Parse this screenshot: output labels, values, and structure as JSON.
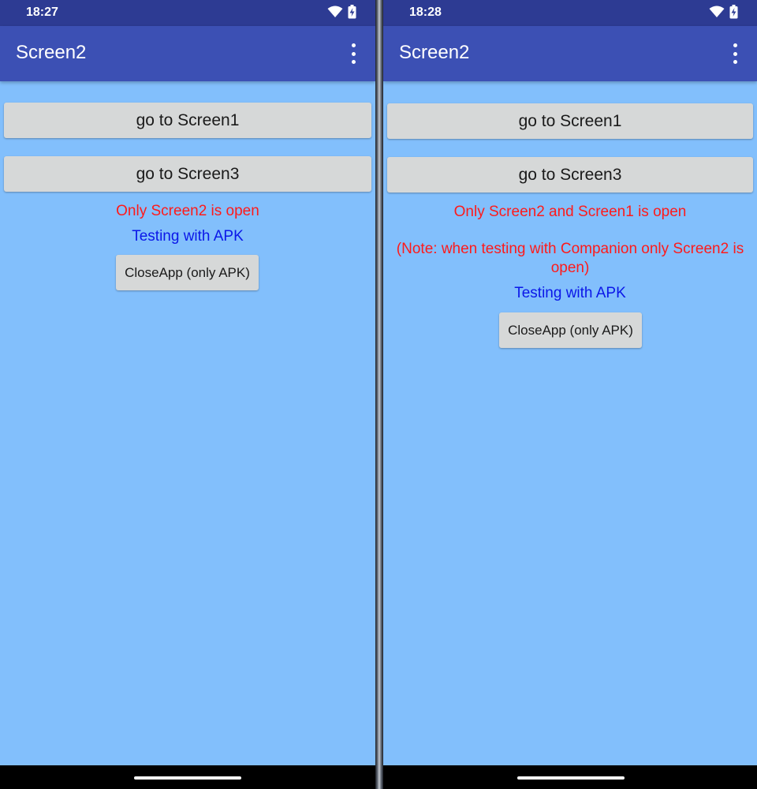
{
  "left": {
    "status": {
      "time": "18:27"
    },
    "app_bar": {
      "title": "Screen2",
      "menu_icon": "more-vert-icon"
    },
    "buttons": {
      "go_screen1": "go to Screen1",
      "go_screen3": "go to Screen3",
      "close_app": "CloseApp (only APK)"
    },
    "messages": {
      "status": "Only Screen2 is open",
      "testing": "Testing with APK"
    }
  },
  "right": {
    "status": {
      "time": "18:28"
    },
    "app_bar": {
      "title": "Screen2",
      "menu_icon": "more-vert-icon"
    },
    "buttons": {
      "go_screen1": "go to Screen1",
      "go_screen3": "go to Screen3",
      "close_app": "CloseApp (only APK)"
    },
    "messages": {
      "status": "Only Screen2 and Screen1 is open",
      "note_line1": "(Note: when testing with Companion only Screen2 is",
      "note_line2": "open)",
      "testing": "Testing with APK"
    }
  },
  "colors": {
    "status_bar": "#2d3b93",
    "app_bar": "#3c50b4",
    "screen_background": "#82bffc",
    "button": "#d6d8d8",
    "text_red": "#ff1a1a",
    "text_blue": "#0b17e8"
  },
  "icons": {
    "wifi": "wifi-icon",
    "battery": "battery-charging-icon",
    "menu": "more-vert-icon"
  }
}
